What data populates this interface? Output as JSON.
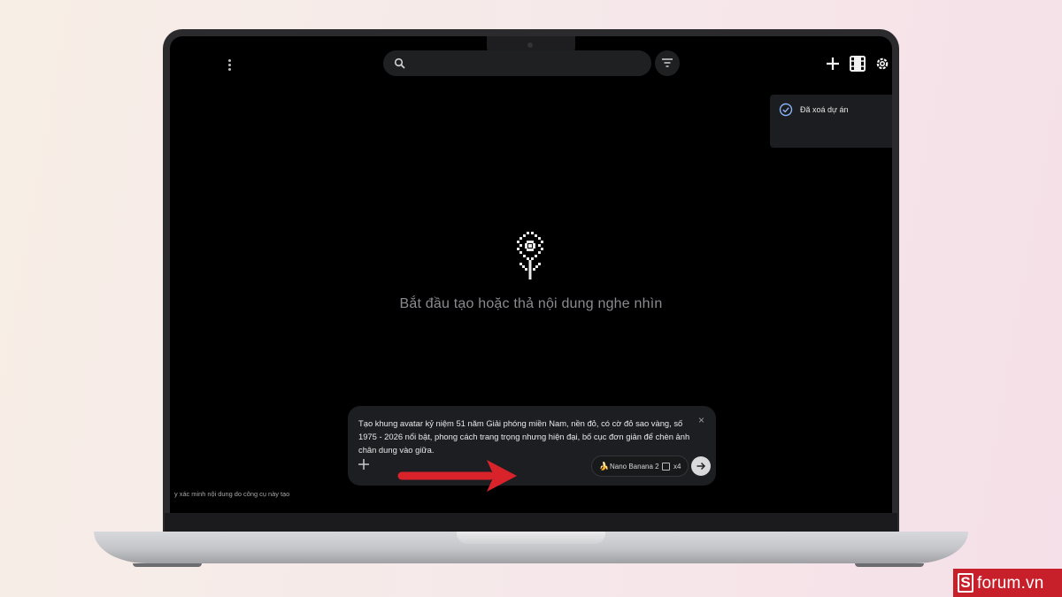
{
  "app": {
    "toast": {
      "text": "Đã xoá dự án",
      "icon": "check-circle-icon"
    },
    "empty_state": {
      "text": "Bắt đầu tạo hoặc thả nội dung nghe nhìn",
      "icon": "flower-icon"
    },
    "search": {
      "value": "",
      "icon": "search-icon"
    },
    "toolbar": {
      "icons": [
        "plus-icon",
        "film-icon",
        "gear-icon"
      ]
    },
    "prompt": {
      "text": "Tạo khung avatar kỷ niệm 51 năm Giải phóng miền Nam, nền đỏ, có cờ đỏ sao vàng, số 1975 - 2026 nổi bật, phong cách trang trọng nhưng hiện đại, bố cục đơn giản để chèn ảnh chân dung vào giữa.",
      "close": "×",
      "model_name": "Nano Banana 2",
      "output_count": "x4"
    },
    "disclaimer": "y xác minh nội dung do công cụ này tạo"
  },
  "colors": {
    "arrow": "#d8232a",
    "logo_bg": "#c8202b",
    "accent_check": "#8ab4f8"
  },
  "watermark": {
    "brand": "forum.vn",
    "letter": "S"
  }
}
